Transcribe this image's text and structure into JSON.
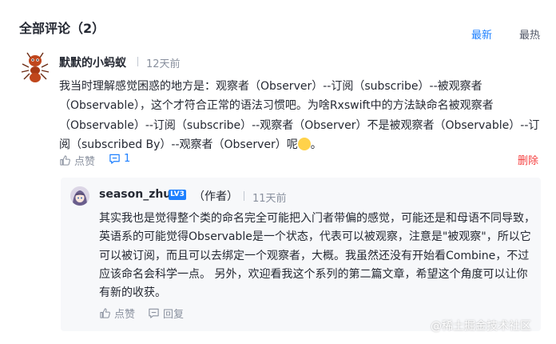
{
  "header": {
    "title": "全部评论（2）",
    "sort_newest": "最新",
    "sort_hot": "最热"
  },
  "comment": {
    "user": "默默的小蚂蚁",
    "time": "12天前",
    "text": "我当时理解感觉困惑的地方是：观察者（Observer）--订阅（subscribe）--被观察者（Observable），这个才符合正常的语法习惯吧。为啥Rxswift中的方法缺命名被观察者（Observable）--订阅（subscribe）--观察者（Observer）不是被观察者（Observable）--订阅（subscribed By）--观察者（Observer）呢",
    "text_end": "。",
    "like_label": "点赞",
    "reply_count": "1",
    "delete_label": "删除"
  },
  "reply": {
    "user": "season_zhu",
    "level": "LV3",
    "author_tag": "（作者）",
    "time": "11天前",
    "text": "其实我也是觉得整个类的命名完全可能把入门者带偏的感觉，可能还是和母语不同导致，英语系的可能觉得Observable是一个状态，代表可以被观察，注意是\"被观察\"，所以它可以被订阅，而且可以去绑定一个观察者，大概。我虽然还没有开始看Combine，不过应该命名会科学一点。 另外，欢迎看我这个系列的第二篇文章，希望这个角度可以让你有新的收获。",
    "like_label": "点赞",
    "reply_label": "回复"
  },
  "watermark": "@稀土掘金技术社区",
  "colors": {
    "accent": "#1e80ff",
    "delete": "#f53f3f",
    "muted": "#8a919f",
    "reply_bg": "#f7f8fa"
  }
}
